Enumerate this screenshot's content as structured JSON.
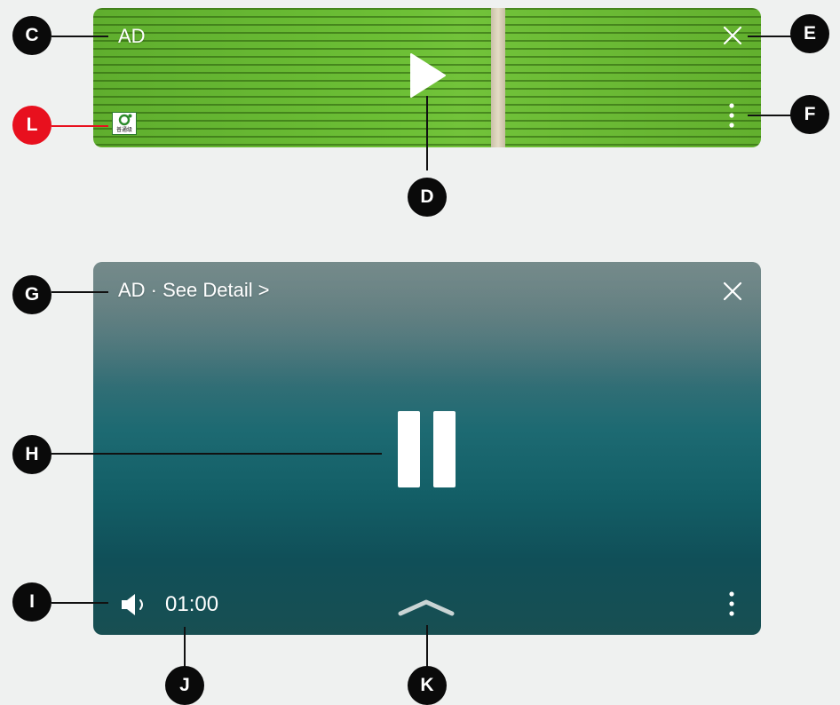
{
  "top_player": {
    "ad_label": "AD",
    "badge_text": "普通级",
    "icons": {
      "close": "close-icon",
      "more": "more-vertical-icon",
      "play": "play-icon",
      "badge": "rating-badge-icon"
    }
  },
  "bottom_player": {
    "ad_label": "AD · See Detail",
    "detail_chevron": ">",
    "time": "01:00",
    "icons": {
      "close": "close-icon",
      "more": "more-vertical-icon",
      "pause": "pause-icon",
      "volume": "volume-icon",
      "expand": "chevron-up-icon"
    }
  },
  "callouts": {
    "C": "C",
    "D": "D",
    "E": "E",
    "F": "F",
    "G": "G",
    "H": "H",
    "I": "I",
    "J": "J",
    "K": "K",
    "L": "L"
  },
  "colors": {
    "callout": "#0a0a0a",
    "callout_highlight": "#e8101e",
    "background": "#eff1f0"
  }
}
